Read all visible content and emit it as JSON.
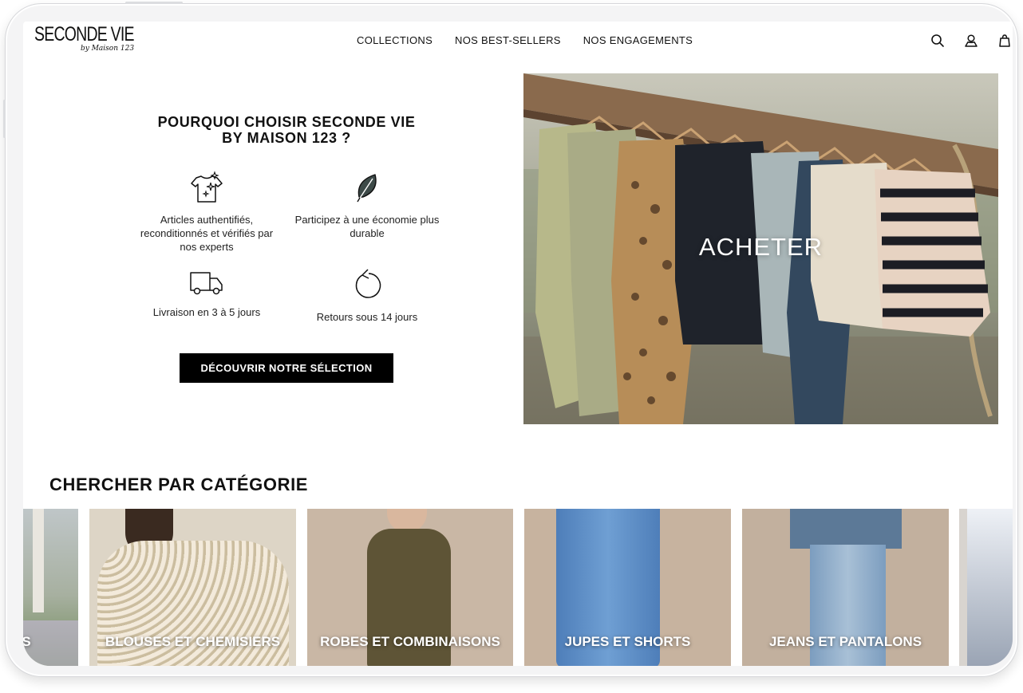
{
  "brand": {
    "logo_text": "SECONDE VIE",
    "logo_sub": "by Maison 123"
  },
  "nav": {
    "items": [
      "COLLECTIONS",
      "NOS BEST-SELLERS",
      "NOS ENGAGEMENTS"
    ]
  },
  "header_icons": [
    "search-icon",
    "account-icon",
    "cart-icon"
  ],
  "why": {
    "title": "POURQUOI CHOISIR SECONDE VIE BY MAISON 123 ?",
    "features": [
      {
        "icon": "sparkle-shirt-icon",
        "label": "Articles authentifiés, reconditionnés et vérifiés par nos experts"
      },
      {
        "icon": "leaf-icon",
        "label": "Participez à une économie plus durable"
      },
      {
        "icon": "delivery-truck-icon",
        "label": "Livraison en 3 à 5 jours"
      },
      {
        "icon": "return-arrow-icon",
        "label": "Retours sous 14 jours"
      }
    ],
    "cta": "DÉCOUVRIR NOTRE SÉLECTION"
  },
  "hero": {
    "label": "ACHETER"
  },
  "categories": {
    "title": "CHERCHER PAR CATÉGORIE",
    "items": [
      {
        "label": "TS"
      },
      {
        "label": "BLOUSES ET CHEMISIERS"
      },
      {
        "label": "ROBES ET COMBINAISONS"
      },
      {
        "label": "JUPES ET SHORTS"
      },
      {
        "label": "JEANS ET PANTALONS"
      }
    ]
  },
  "colors": {
    "accent": "#000000",
    "text": "#111111"
  }
}
